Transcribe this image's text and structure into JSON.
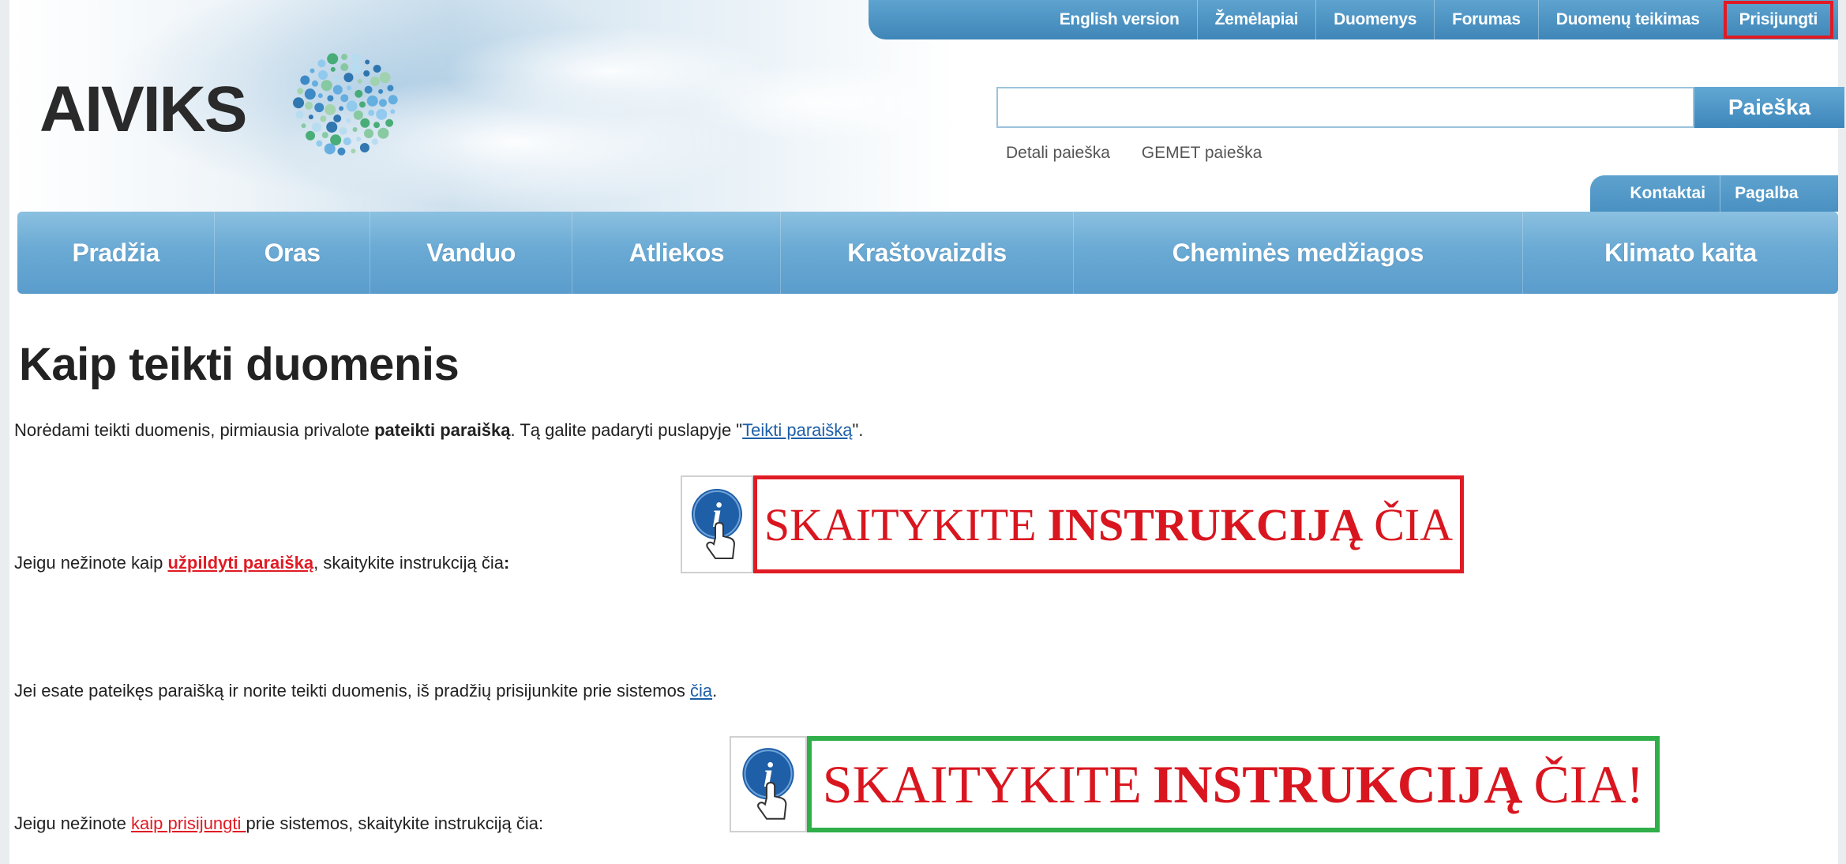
{
  "top_nav": {
    "items": [
      "English version",
      "Žemėlapiai",
      "Duomenys",
      "Forumas",
      "Duomenų teikimas"
    ],
    "login_label": "Prisijungti"
  },
  "logo": {
    "text": "AIVIKS"
  },
  "search": {
    "placeholder": "",
    "button_label": "Paieška",
    "detail_link": "Detali paieška",
    "gemet_link": "GEMET paieška"
  },
  "contact_tabs": [
    "Kontaktai",
    "Pagalba"
  ],
  "main_nav": [
    "Pradžia",
    "Oras",
    "Vanduo",
    "Atliekos",
    "Kraštovaizdis",
    "Cheminės medžiagos",
    "Klimato kaita"
  ],
  "page": {
    "title": "Kaip teikti duomenis",
    "p1_before": "Norėdami teikti duomenis, pirmiausia privalote ",
    "p1_bold": "pateikti paraišką",
    "p1_mid": ". Tą galite padaryti puslapyje \"",
    "p1_link": "Teikti paraišką",
    "p1_after": "\".",
    "p2_before": "Jeigu nežinote kaip ",
    "p2_red": "užpildyti paraišką",
    "p2_after": ", skaitykite instrukciją čia",
    "p2_colon": ":",
    "p3_before": "Jei esate pateikęs paraišką ir norite teikti duomenis, iš pradžių prisijunkite prie sistemos ",
    "p3_link": "čia",
    "p3_after": ".",
    "p4_before": "Jeigu nežinote ",
    "p4_red": "kaip prisijungti ",
    "p4_after": "prie sistemos, skaitykite instrukciją čia:"
  },
  "banner1": {
    "part1": "SKAITYKITE",
    "part2": "INSTRUKCIJĄ",
    "part3": "ČIA",
    "border_color": "#e01b24"
  },
  "banner2": {
    "part1": "SKAITYKITE",
    "part2": "INSTRUKCIJĄ",
    "part3": "ČIA!",
    "border_color": "#2fae4a"
  },
  "icons": {
    "info": "info-hand-icon",
    "logo": "dotted-circle-logo-icon"
  }
}
